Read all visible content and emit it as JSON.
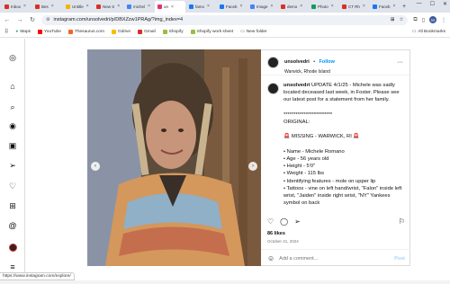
{
  "tabs": [
    {
      "label": "Inbox",
      "color": "#d93025",
      "active": false
    },
    {
      "label": "Bes",
      "color": "#d93025",
      "active": false
    },
    {
      "label": "Untitle",
      "color": "#f4b400",
      "active": false
    },
    {
      "label": "New S",
      "color": "#d93025",
      "active": false
    },
    {
      "label": "michel",
      "color": "#4285f4",
      "active": false
    },
    {
      "label": "un",
      "color": "#e1306c",
      "active": true
    },
    {
      "label": "famo",
      "color": "#1877f2",
      "active": false
    },
    {
      "label": "Faceb",
      "color": "#1877f2",
      "active": false
    },
    {
      "label": "Image",
      "color": "#4285f4",
      "active": false
    },
    {
      "label": "demo",
      "color": "#d93025",
      "active": false
    },
    {
      "label": "Photo",
      "color": "#0f9d58",
      "active": false
    },
    {
      "label": "CT Rh",
      "color": "#d93025",
      "active": false
    },
    {
      "label": "Faceb",
      "color": "#1877f2",
      "active": false
    }
  ],
  "url": "instagram.com/unsolvedri/p/DBXZzw1PRAg/?img_index=4",
  "profile_initial": "M",
  "bookmarks": [
    "Maps",
    "YouTube",
    "Thesaurus.com",
    "Gdrive",
    "Gmail",
    "Shopify",
    "Shopify work sheet",
    "New folder"
  ],
  "all_bookmarks": "All Bookmarks",
  "post": {
    "username": "unsolvedri",
    "separator": "•",
    "follow_label": "Follow",
    "location": "Warwick, Rhode Island",
    "caption_user": "unsolvedri",
    "caption_lines": [
      "UPDATE 4/1/25 - Michele was sadly located deceased last week, in Foster. Please see our latest post for a statement from her family.",
      "",
      "************************",
      "ORIGINAL:",
      "",
      "🚨 MISSING - WARWICK, RI 🚨",
      "",
      "• Name - Michele Romano",
      "• Age - 56 years old",
      "• Height - 5'0\"",
      "• Weight - 115 lbs",
      "• Identifying features - mole on upper lip",
      "• Tattoos - vine on left hand/wrist, \"Falon\" inside left wrist, \"Jaiden\" inside right wrist, \"NY\" Yankees symbol on back"
    ],
    "likes": "86 likes",
    "date": "October 21, 2024",
    "comment_placeholder": "Add a comment...",
    "post_label": "Post"
  },
  "status_url": "https://www.instagram.com/explore/",
  "colors": {
    "follow": "#0095f6",
    "accent": "#e1306c"
  }
}
